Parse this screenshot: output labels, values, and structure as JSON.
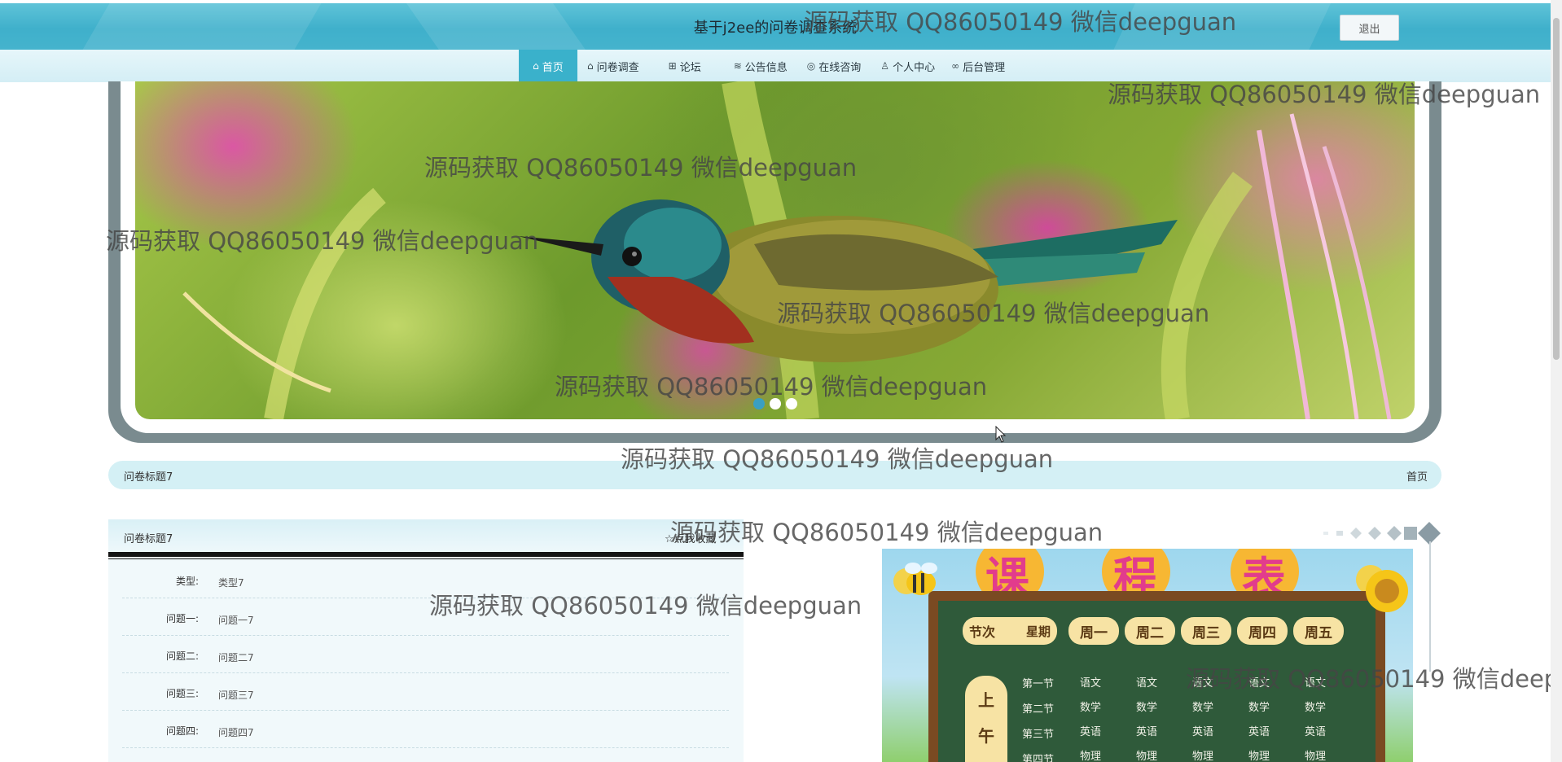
{
  "header": {
    "title": "基于j2ee的问卷调查系统",
    "logout_label": "退出"
  },
  "nav": {
    "items": [
      {
        "icon": "home-icon",
        "label": "首页",
        "active": true
      },
      {
        "icon": "tag-icon",
        "label": "问卷调查"
      },
      {
        "icon": "forum-icon",
        "label": "论坛"
      },
      {
        "icon": "layers-icon",
        "label": "公告信息"
      },
      {
        "icon": "globe-icon",
        "label": "在线咨询"
      },
      {
        "icon": "user-icon",
        "label": "个人中心"
      },
      {
        "icon": "link-icon",
        "label": "后台管理"
      }
    ]
  },
  "banner": {
    "dots": 3,
    "active_dot": 1
  },
  "breadcrumb": {
    "title": "问卷标题7",
    "home_link": "首页"
  },
  "detail": {
    "title": "问卷标题7",
    "favorite_label": "点我收藏",
    "fields": [
      {
        "label": "类型:",
        "value": "类型7"
      },
      {
        "label": "问题一:",
        "value": "问题一7"
      },
      {
        "label": "问题二:",
        "value": "问题二7"
      },
      {
        "label": "问题三:",
        "value": "问题三7"
      },
      {
        "label": "问题四:",
        "value": "问题四7"
      }
    ]
  },
  "schedule": {
    "title_chars": [
      "课",
      "程",
      "表"
    ],
    "corner_top": "星期",
    "corner_bottom": "节次",
    "days": [
      "周一",
      "周二",
      "周三",
      "周四",
      "周五"
    ],
    "period_group": [
      "上",
      "午"
    ],
    "periods": [
      "第一节",
      "第二节",
      "第三节",
      "第四节"
    ],
    "subjects": [
      [
        "语文",
        "语文",
        "语文",
        "语文",
        "语文"
      ],
      [
        "数学",
        "数学",
        "数学",
        "数学",
        "数学"
      ],
      [
        "英语",
        "英语",
        "英语",
        "英语",
        "英语"
      ],
      [
        "物理",
        "物理",
        "物理",
        "物理",
        "物理"
      ]
    ]
  },
  "watermark": {
    "text": "源码获取 QQ86050149 微信deepguan"
  },
  "colors": {
    "header_teal": "#3fb0cb",
    "nav_active": "#3ab1cb",
    "breadcrumb_bg": "#d4f0f5",
    "panel_bg": "#f1f9fb"
  }
}
